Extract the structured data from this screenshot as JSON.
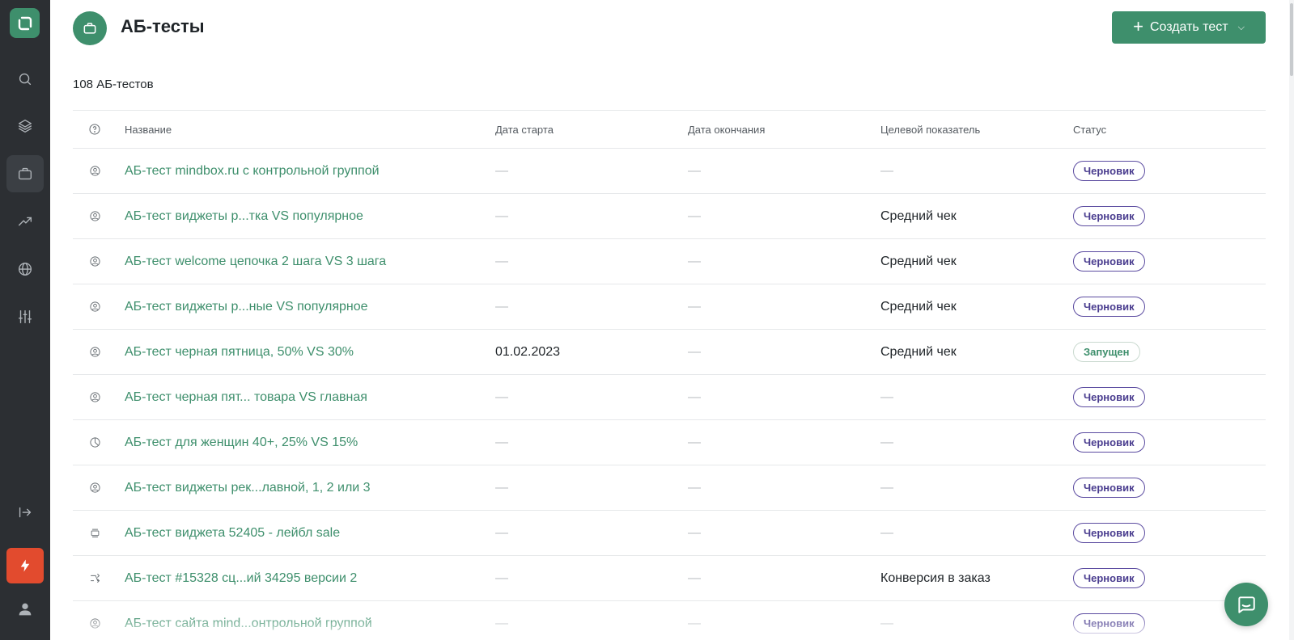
{
  "page": {
    "title": "АБ-тесты",
    "create_button": "Создать тест",
    "count": "108 АБ-тестов"
  },
  "table": {
    "columns": [
      "Название",
      "Дата старта",
      "Дата окончания",
      "Целевой показатель",
      "Статус"
    ],
    "rows": [
      {
        "icon": "user-circle-icon",
        "name": "АБ-тест mindbox.ru с контрольной группой",
        "start": "—",
        "end": "—",
        "target": "—",
        "status": "Черновик"
      },
      {
        "icon": "user-circle-icon",
        "name": "АБ-тест виджеты р...тка VS популярное",
        "start": "—",
        "end": "—",
        "target": "Средний чек",
        "status": "Черновик"
      },
      {
        "icon": "user-circle-icon",
        "name": "АБ-тест welcome цепочка 2 шага VS 3 шага",
        "start": "—",
        "end": "—",
        "target": "Средний чек",
        "status": "Черновик"
      },
      {
        "icon": "user-circle-icon",
        "name": "АБ-тест виджеты р...ные VS популярное",
        "start": "—",
        "end": "—",
        "target": "Средний чек",
        "status": "Черновик"
      },
      {
        "icon": "user-circle-icon",
        "name": "АБ-тест черная пятница, 50% VS 30%",
        "start": "01.02.2023",
        "end": "—",
        "target": "Средний чек",
        "status": "Запущен"
      },
      {
        "icon": "user-circle-icon",
        "name": "АБ-тест черная пят... товара VS главная",
        "start": "—",
        "end": "—",
        "target": "—",
        "status": "Черновик"
      },
      {
        "icon": "pie-chart-icon",
        "name": "АБ-тест для женщин 40+, 25% VS 15%",
        "start": "—",
        "end": "—",
        "target": "—",
        "status": "Черновик"
      },
      {
        "icon": "user-circle-icon",
        "name": "АБ-тест виджеты рек...лавной, 1, 2 или 3",
        "start": "—",
        "end": "—",
        "target": "—",
        "status": "Черновик"
      },
      {
        "icon": "widget-icon",
        "name": "АБ-тест виджета 52405 - лейбл sale",
        "start": "—",
        "end": "—",
        "target": "—",
        "status": "Черновик"
      },
      {
        "icon": "flow-icon",
        "name": "АБ-тест #15328 сц...ий 34295 версии 2",
        "start": "—",
        "end": "—",
        "target": "Конверсия в заказ",
        "status": "Черновик"
      },
      {
        "icon": "user-circle-icon",
        "name": "АБ-тест сайта mind...онтрольной группой",
        "start": "—",
        "end": "—",
        "target": "—",
        "status": "Черновик"
      }
    ]
  },
  "colors": {
    "accent": "#3e8f6c",
    "sidebar": "#2c2f33",
    "draft_badge": "#4a3d8f",
    "bolt": "#e24b2e"
  }
}
